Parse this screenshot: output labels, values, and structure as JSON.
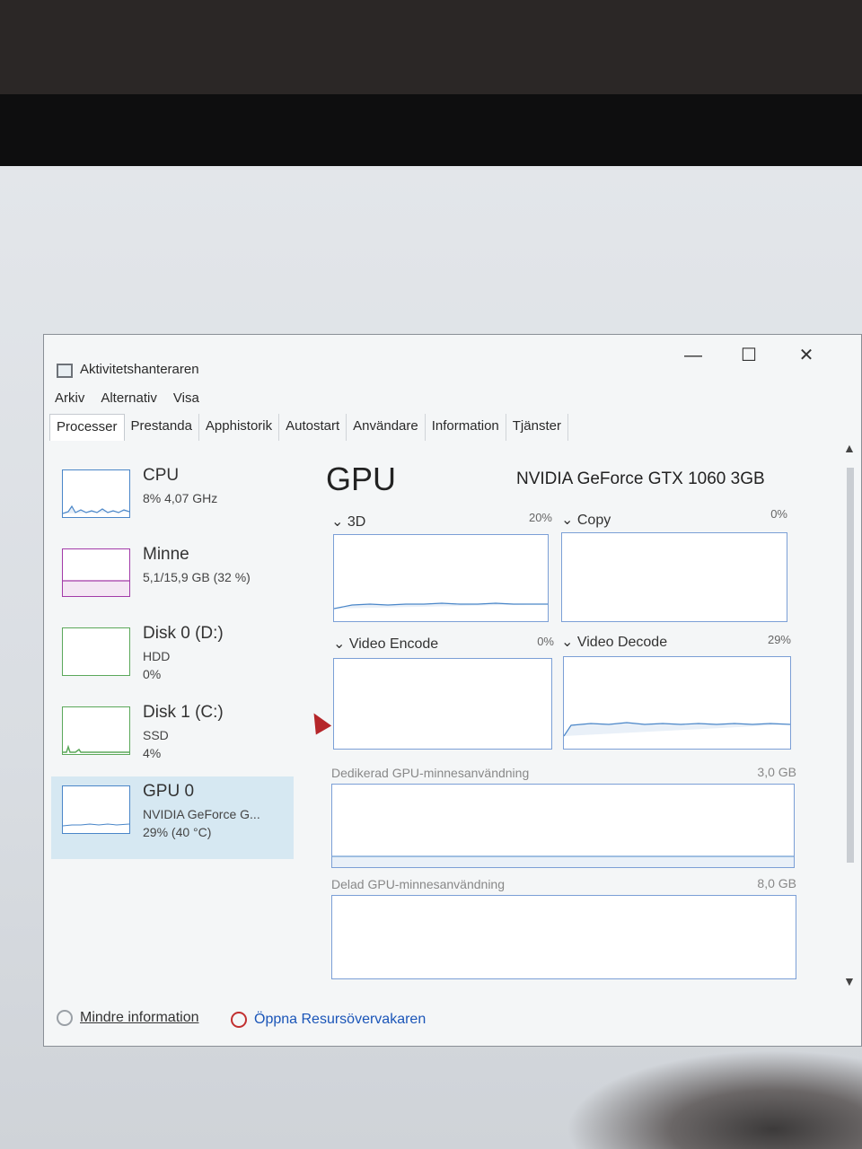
{
  "window": {
    "title": "Aktivitetshanteraren"
  },
  "menu": [
    "Arkiv",
    "Alternativ",
    "Visa"
  ],
  "tabs": [
    {
      "label": "Processer",
      "active": true
    },
    {
      "label": "Prestanda",
      "active": false
    },
    {
      "label": "Apphistorik",
      "active": false
    },
    {
      "label": "Autostart",
      "active": false
    },
    {
      "label": "Användare",
      "active": false
    },
    {
      "label": "Information",
      "active": false
    },
    {
      "label": "Tjänster",
      "active": false
    }
  ],
  "sidebar": {
    "items": [
      {
        "name": "CPU",
        "line1": "8% 4,07 GHz",
        "line2": "",
        "line3": "",
        "color": "#4a86c8"
      },
      {
        "name": "Minne",
        "line1": "5,1/15,9 GB (32 %)",
        "line2": "",
        "line3": "",
        "color": "#a23aa8"
      },
      {
        "name": "Disk 0 (D:)",
        "line1": "HDD",
        "line2": "0%",
        "line3": "",
        "color": "#5ba85a"
      },
      {
        "name": "Disk 1 (C:)",
        "line1": "SSD",
        "line2": "4%",
        "line3": "",
        "color": "#5ba85a"
      },
      {
        "name": "GPU 0",
        "line1": "NVIDIA GeForce G...",
        "line2": "29% (40 °C)",
        "line3": "",
        "color": "#4a86c8"
      }
    ]
  },
  "gpu": {
    "title": "GPU",
    "model": "NVIDIA GeForce GTX 1060 3GB",
    "engines": [
      {
        "label": "3D",
        "percent": "20%",
        "level": 0.2
      },
      {
        "label": "Copy",
        "percent": "0%",
        "level": 0.0
      },
      {
        "label": "Video Encode",
        "percent": "0%",
        "level": 0.0
      },
      {
        "label": "Video Decode",
        "percent": "29%",
        "level": 0.29
      }
    ],
    "dedicated": {
      "label": "Dedikerad GPU-minnesanvändning",
      "value": "3,0 GB"
    },
    "shared": {
      "label": "Delad GPU-minnesanvändning",
      "value": "8,0 GB"
    }
  },
  "footer": {
    "less_info": "Mindre information",
    "open_monitor": "Öppna Resursövervakaren"
  },
  "colors": {
    "graph_blue": "#4a86c8",
    "selected_bg": "#d6e8f2",
    "link": "#1a55b8"
  }
}
